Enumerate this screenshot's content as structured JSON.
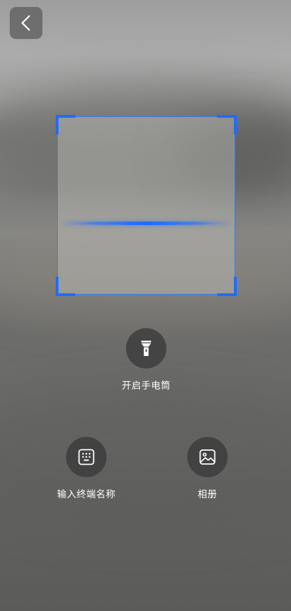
{
  "navigation": {
    "back_icon": "chevron-left-icon"
  },
  "scanner": {
    "frame_color": "#1e6cff",
    "line_color": "#1a6cff"
  },
  "actions": {
    "flashlight": {
      "label": "开启手电筒",
      "icon": "flashlight-icon"
    },
    "terminal_name": {
      "label": "输入终端名称",
      "icon": "keypad-icon"
    },
    "album": {
      "label": "相册",
      "icon": "gallery-icon"
    }
  }
}
